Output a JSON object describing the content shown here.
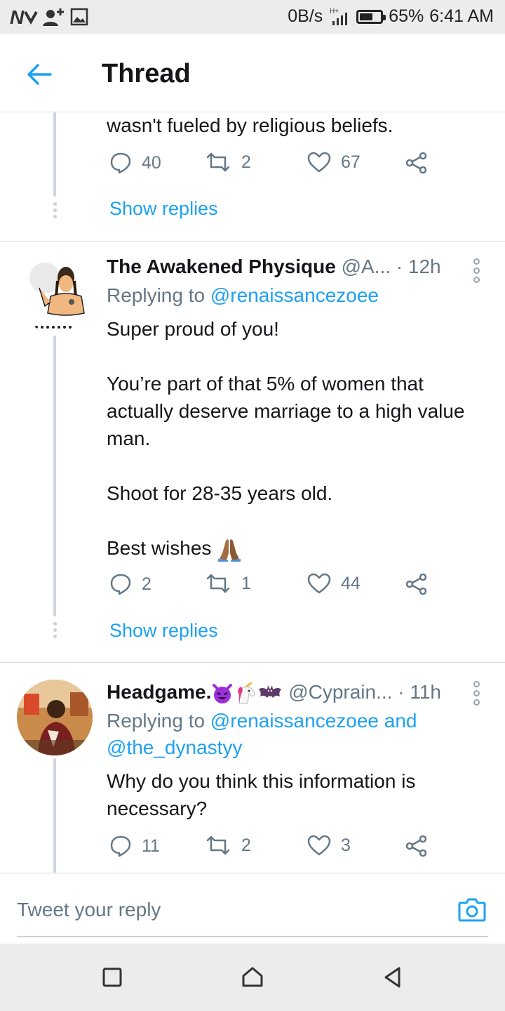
{
  "status_bar": {
    "left_icons": [
      "nfc-icon",
      "add-person-icon",
      "image-icon"
    ],
    "net_speed": "0B/s",
    "battery": "65%",
    "battery_level": 0.65,
    "time": "6:41 AM"
  },
  "header": {
    "title": "Thread"
  },
  "tweets": [
    {
      "text": "wasn't fueled by religious beliefs.",
      "replies": "40",
      "retweets": "2",
      "likes": "67",
      "show_replies": "Show replies"
    },
    {
      "name": "The Awakened Physique",
      "handle": "@A...",
      "time": "· 12h",
      "replying_label": "Replying to",
      "replying_to": "@renaissancezoee",
      "text": "Super proud of you!\n\nYou’re part of that 5% of women that actually deserve marriage to a high value man.\n\nShoot for 28-35 years old.\n\nBest wishes",
      "replies": "2",
      "retweets": "1",
      "likes": "44",
      "show_replies": "Show replies"
    },
    {
      "name": "Headgame.",
      "handle": "@Cyprain...",
      "time": "· 11h",
      "replying_label": "Replying to",
      "replying_to": "@renaissancezoee and @the_dynastyy",
      "text": "Why do you think this information is necessary?",
      "replies": "11",
      "retweets": "2",
      "likes": "3"
    }
  ],
  "reply_bar": {
    "placeholder": "Tweet your reply"
  },
  "nav_bar": {
    "buttons": [
      "recents-button",
      "home-button",
      "back-button"
    ]
  },
  "colors": {
    "accent": "#1da1f2",
    "secondary_text": "#657786",
    "thread_line": "#cdd6dd"
  }
}
